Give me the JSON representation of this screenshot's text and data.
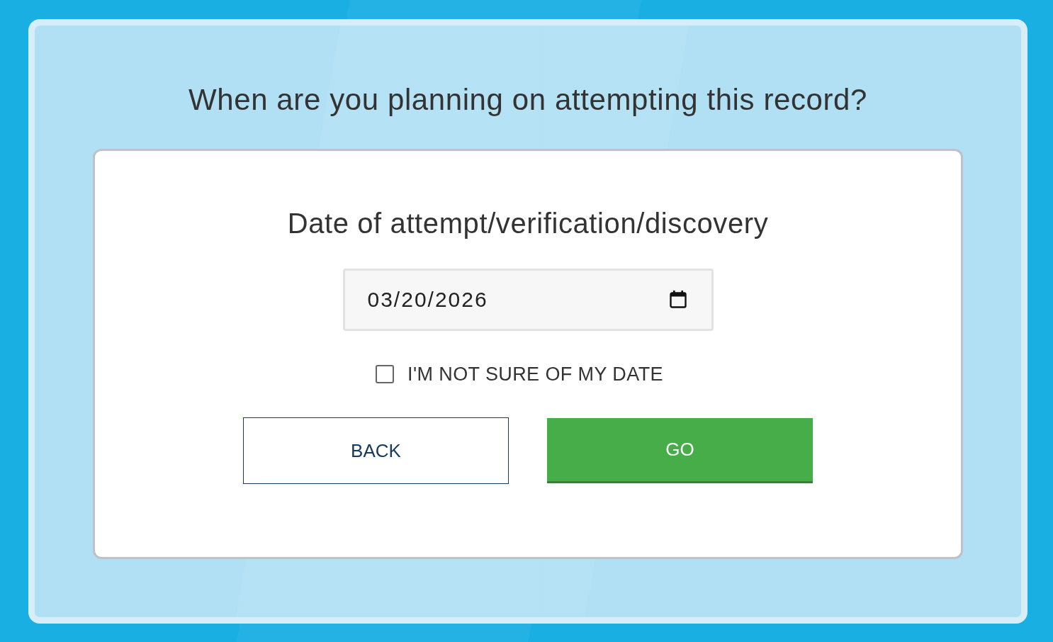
{
  "question": "When are you planning on attempting this record?",
  "form": {
    "label": "Date of attempt/verification/discovery",
    "date_field": {
      "value": "03/20/2026"
    },
    "unsure_checkbox": {
      "label": "I'M NOT SURE OF MY DATE",
      "checked": false
    },
    "buttons": [
      {
        "label": "BACK",
        "kind": "secondary"
      },
      {
        "label": "GO",
        "kind": "primary"
      }
    ]
  }
}
